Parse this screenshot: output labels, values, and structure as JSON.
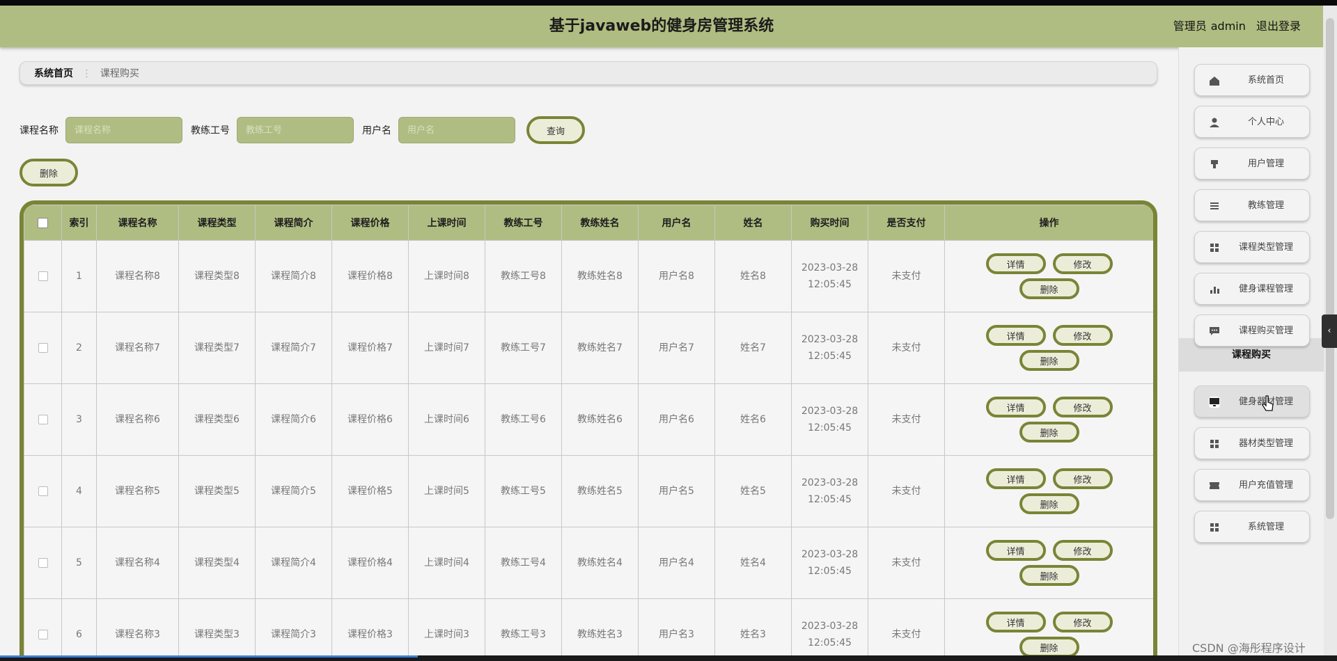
{
  "header": {
    "title": "基于javaweb的健身房管理系统",
    "role": "管理员",
    "username": "admin",
    "logout": "退出登录"
  },
  "breadcrumb": {
    "home": "系统首页",
    "current": "课程购买"
  },
  "search": {
    "fields": [
      {
        "label": "课程名称",
        "placeholder": "课程名称"
      },
      {
        "label": "教练工号",
        "placeholder": "教练工号"
      },
      {
        "label": "用户名",
        "placeholder": "用户名"
      }
    ],
    "query_label": "查询",
    "delete_label": "删除"
  },
  "table": {
    "columns": [
      "索引",
      "课程名称",
      "课程类型",
      "课程简介",
      "课程价格",
      "上课时间",
      "教练工号",
      "教练姓名",
      "用户名",
      "姓名",
      "购买时间",
      "是否支付",
      "操作"
    ],
    "rows": [
      {
        "index": "1",
        "name": "课程名称8",
        "type": "课程类型8",
        "intro": "课程简介8",
        "price": "课程价格8",
        "time": "上课时间8",
        "coach_no": "教练工号8",
        "coach_name": "教练姓名8",
        "username": "用户名8",
        "real_name": "姓名8",
        "buy_date": "2023-03-28",
        "buy_time": "12:05:45",
        "paid": "未支付"
      },
      {
        "index": "2",
        "name": "课程名称7",
        "type": "课程类型7",
        "intro": "课程简介7",
        "price": "课程价格7",
        "time": "上课时间7",
        "coach_no": "教练工号7",
        "coach_name": "教练姓名7",
        "username": "用户名7",
        "real_name": "姓名7",
        "buy_date": "2023-03-28",
        "buy_time": "12:05:45",
        "paid": "未支付"
      },
      {
        "index": "3",
        "name": "课程名称6",
        "type": "课程类型6",
        "intro": "课程简介6",
        "price": "课程价格6",
        "time": "上课时间6",
        "coach_no": "教练工号6",
        "coach_name": "教练姓名6",
        "username": "用户名6",
        "real_name": "姓名6",
        "buy_date": "2023-03-28",
        "buy_time": "12:05:45",
        "paid": "未支付"
      },
      {
        "index": "4",
        "name": "课程名称5",
        "type": "课程类型5",
        "intro": "课程简介5",
        "price": "课程价格5",
        "time": "上课时间5",
        "coach_no": "教练工号5",
        "coach_name": "教练姓名5",
        "username": "用户名5",
        "real_name": "姓名5",
        "buy_date": "2023-03-28",
        "buy_time": "12:05:45",
        "paid": "未支付"
      },
      {
        "index": "5",
        "name": "课程名称4",
        "type": "课程类型4",
        "intro": "课程简介4",
        "price": "课程价格4",
        "time": "上课时间4",
        "coach_no": "教练工号4",
        "coach_name": "教练姓名4",
        "username": "用户名4",
        "real_name": "姓名4",
        "buy_date": "2023-03-28",
        "buy_time": "12:05:45",
        "paid": "未支付"
      },
      {
        "index": "6",
        "name": "课程名称3",
        "type": "课程类型3",
        "intro": "课程简介3",
        "price": "课程价格3",
        "time": "上课时间3",
        "coach_no": "教练工号3",
        "coach_name": "教练姓名3",
        "username": "用户名3",
        "real_name": "姓名3",
        "buy_date": "2023-03-28",
        "buy_time": "12:05:45",
        "paid": "未支付"
      }
    ],
    "actions": {
      "detail": "详情",
      "edit": "修改",
      "delete": "删除"
    }
  },
  "sidebar": {
    "items": [
      {
        "label": "系统首页",
        "icon": "home-icon"
      },
      {
        "label": "个人中心",
        "icon": "person-icon"
      },
      {
        "label": "用户管理",
        "icon": "user-manage-icon"
      },
      {
        "label": "教练管理",
        "icon": "list-icon"
      },
      {
        "label": "课程类型管理",
        "icon": "grid-icon"
      },
      {
        "label": "健身课程管理",
        "icon": "bar-chart-icon"
      },
      {
        "label": "课程购买管理",
        "icon": "message-icon"
      },
      {
        "label": "健身器材管理",
        "icon": "monitor-icon"
      },
      {
        "label": "器材类型管理",
        "icon": "grid-icon"
      },
      {
        "label": "用户充值管理",
        "icon": "ticket-icon"
      },
      {
        "label": "系统管理",
        "icon": "grid-icon"
      }
    ],
    "submenu_label": "课程购买"
  },
  "watermark": "CSDN @海彤程序设计",
  "colors": {
    "header": "#b0bd82",
    "accent_border": "#7a8436",
    "bg": "#f3f3f3"
  }
}
